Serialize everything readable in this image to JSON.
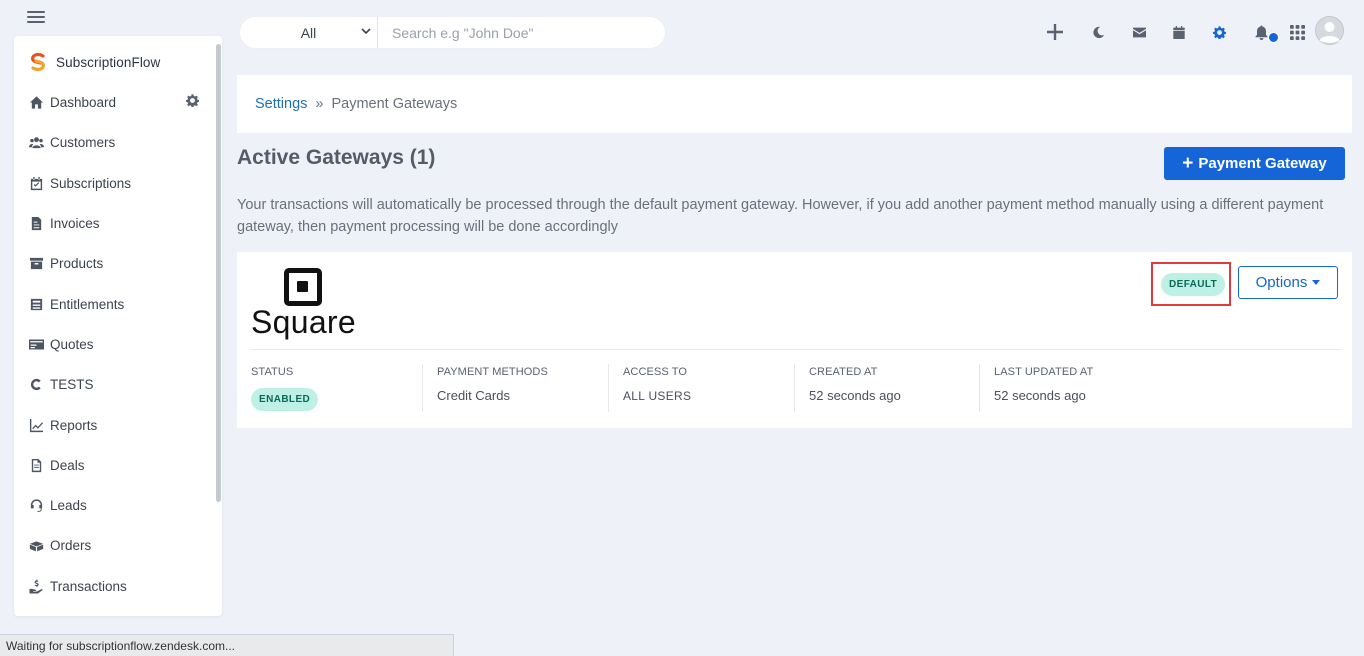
{
  "app": {
    "brand_name": "SubscriptionFlow"
  },
  "sidebar": {
    "items": [
      {
        "label": "Dashboard",
        "icon": "home-icon"
      },
      {
        "label": "Customers",
        "icon": "users-icon"
      },
      {
        "label": "Subscriptions",
        "icon": "calendar-check-icon"
      },
      {
        "label": "Invoices",
        "icon": "invoice-icon"
      },
      {
        "label": "Products",
        "icon": "box-icon"
      },
      {
        "label": "Entitlements",
        "icon": "archive-icon"
      },
      {
        "label": "Quotes",
        "icon": "quote-card-icon"
      },
      {
        "label": "TESTS",
        "icon": "c-letter-icon"
      },
      {
        "label": "Reports",
        "icon": "chart-line-icon"
      },
      {
        "label": "Deals",
        "icon": "document-icon"
      },
      {
        "label": "Leads",
        "icon": "headset-icon"
      },
      {
        "label": "Orders",
        "icon": "boxes-icon"
      },
      {
        "label": "Transactions",
        "icon": "hand-dollar-icon"
      }
    ]
  },
  "search": {
    "scope_selected": "All",
    "placeholder": "Search e.g \"John Doe\"",
    "value": ""
  },
  "breadcrumb": {
    "parent": "Settings",
    "separator": "»",
    "current": "Payment Gateways"
  },
  "page": {
    "title": "Active Gateways (1)",
    "add_button_label": "Payment Gateway",
    "description": "Your transactions will automatically be processed through the default payment gateway. However, if you add another payment method manually using a different payment gateway, then payment processing will be done accordingly"
  },
  "gateway": {
    "logo_text": "Square",
    "default_badge": "DEFAULT",
    "options_label": "Options",
    "meta": {
      "status_label": "STATUS",
      "status_value": "ENABLED",
      "payment_methods_label": "PAYMENT METHODS",
      "payment_methods_value": "Credit Cards",
      "access_label": "ACCESS TO",
      "access_value": "ALL USERS",
      "created_label": "CREATED AT",
      "created_value": "52 seconds ago",
      "updated_label": "LAST UPDATED AT",
      "updated_value": "52 seconds ago"
    }
  },
  "statusbar": {
    "text": "Waiting for subscriptionflow.zendesk.com..."
  },
  "colors": {
    "primary": "#1565d8",
    "link": "#1f6fb5",
    "badge_bg": "#bff0e6",
    "badge_text": "#0a6b54",
    "highlight": "#e0393e",
    "page_bg": "#eef1f8"
  }
}
